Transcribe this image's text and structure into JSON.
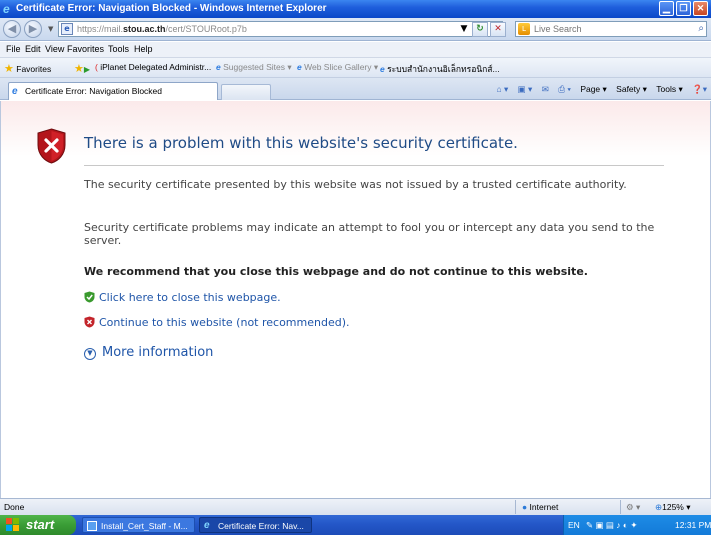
{
  "window": {
    "title": "Certificate Error: Navigation Blocked - Windows Internet Explorer"
  },
  "address_bar": {
    "url_prefix": "https://mail.",
    "url_domain": "stou.ac.th",
    "url_suffix": "/cert/STOURoot.p7b",
    "search_placeholder": "Live Search"
  },
  "menu": {
    "items": [
      "File",
      "Edit",
      "View",
      "Favorites",
      "Tools",
      "Help"
    ]
  },
  "favorites_bar": {
    "favorites_label": "Favorites",
    "items": [
      "iPlanet Delegated Administr...",
      "Suggested Sites ▾",
      "Web Slice Gallery ▾",
      "ระบบสำนักงานอิเล็กทรอนิกส์..."
    ]
  },
  "tab": {
    "active_label": "Certificate Error: Navigation Blocked"
  },
  "command_bar": {
    "page": "Page ▾",
    "safety": "Safety ▾",
    "tools": "Tools ▾"
  },
  "content": {
    "title": "There is a problem with this website's security certificate.",
    "para1": "The security certificate presented by this website was not issued by a trusted certificate authority.",
    "para2": "Security certificate problems may indicate an attempt to fool you or intercept any data you send to the server.",
    "recommend": "We recommend that you close this webpage and do not continue to this website.",
    "close_link": "Click here to close this webpage.",
    "continue_link": "Continue to this website (not recommended).",
    "more_info": "More information"
  },
  "status_bar": {
    "status": "Done",
    "zone": "Internet",
    "zoom": "125%"
  },
  "taskbar": {
    "start": "start",
    "items": [
      "Install_Cert_Staff - M...",
      "Certificate Error: Nav..."
    ],
    "lang": "EN",
    "clock": "12:31 PM"
  },
  "colors": {
    "link": "#1f55a8",
    "title": "#1f4b86",
    "titlebar": "#0a48c8",
    "taskbar": "#2457c8",
    "start_green": "#3a9d36"
  }
}
